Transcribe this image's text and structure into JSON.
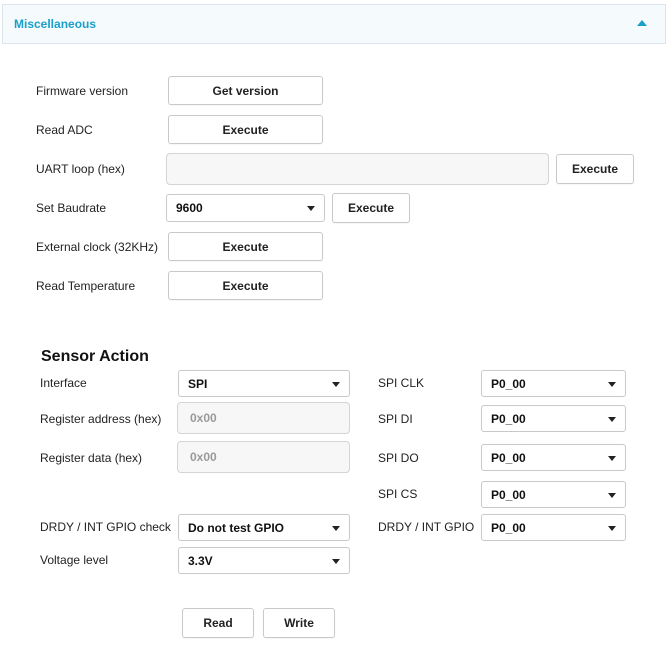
{
  "panel": {
    "title": "Miscellaneous"
  },
  "misc": {
    "firmware_label": "Firmware version",
    "get_version_label": "Get version",
    "read_adc_label": "Read ADC",
    "uart_label": "UART loop (hex)",
    "uart_value": "",
    "baudrate_label": "Set Baudrate",
    "baudrate_value": "9600",
    "ext_clock_label": "External clock (32KHz)",
    "read_temp_label": "Read Temperature",
    "execute_label": "Execute"
  },
  "sensor": {
    "title": "Sensor Action",
    "interface_label": "Interface",
    "interface_value": "SPI",
    "reg_addr_label": "Register address (hex)",
    "reg_addr_placeholder": "0x00",
    "reg_data_label": "Register data (hex)",
    "reg_data_placeholder": "0x00",
    "drdy_check_label": "DRDY / INT GPIO check",
    "drdy_check_value": "Do not test GPIO",
    "voltage_label": "Voltage level",
    "voltage_value": "3.3V",
    "spi_clk_label": "SPI CLK",
    "spi_clk_value": "P0_00",
    "spi_di_label": "SPI DI",
    "spi_di_value": "P0_00",
    "spi_do_label": "SPI DO",
    "spi_do_value": "P0_00",
    "spi_cs_label": "SPI CS",
    "spi_cs_value": "P0_00",
    "drdy_gpio_label": "DRDY / INT GPIO",
    "drdy_gpio_value": "P0_00",
    "read_label": "Read",
    "write_label": "Write"
  },
  "colors": {
    "accent": "#1aa0c9",
    "header_bg": "#f5fafd"
  }
}
